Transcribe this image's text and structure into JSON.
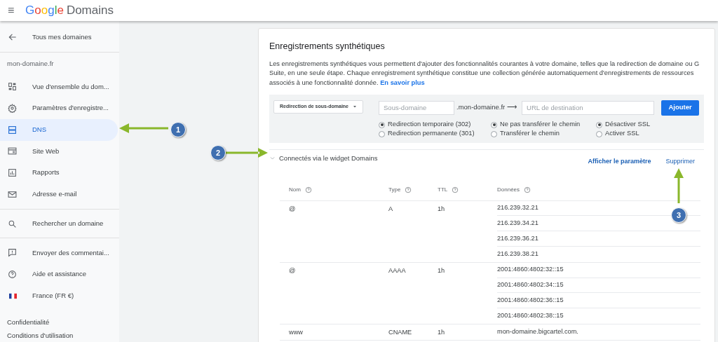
{
  "header": {
    "menu_icon": "≡",
    "logo_brand": "Google",
    "logo_product": "Domains"
  },
  "sidebar": {
    "back": "Tous mes domaines",
    "domain": "mon-domaine.fr",
    "items": [
      {
        "label": "Vue d'ensemble du dom...",
        "selected": false
      },
      {
        "label": "Paramètres d'enregistre...",
        "selected": false
      },
      {
        "label": "DNS",
        "selected": true
      },
      {
        "label": "Site Web",
        "selected": false
      },
      {
        "label": "Rapports",
        "selected": false
      },
      {
        "label": "Adresse e-mail",
        "selected": false
      }
    ],
    "search": "Rechercher un domaine",
    "support": [
      "Envoyer des commentai...",
      "Aide et assistance",
      "France (FR €)"
    ],
    "footer": [
      "Confidentialité",
      "Conditions d'utilisation"
    ]
  },
  "card": {
    "title": "Enregistrements synthétiques",
    "description": "Les enregistrements synthétiques vous permettent d'ajouter des fonctionnalités courantes à votre domaine, telles que la redirection de domaine ou G Suite, en une seule étape. Chaque enregistrement synthétique constitue une collection générée automatiquement d'enregistrements de ressources associés à une fonctionnalité donnée.",
    "learn_more": "En savoir plus",
    "form": {
      "type_select": "Redirection de sous-domaine",
      "subdomain_placeholder": "Sous-domaine",
      "suffix": ".mon-domaine.fr ⟶",
      "url_placeholder": "URL de destination",
      "add_button": "Ajouter",
      "radio_groups": [
        [
          {
            "label": "Redirection temporaire (302)",
            "selected": true
          },
          {
            "label": "Redirection permanente (301)",
            "selected": false
          }
        ],
        [
          {
            "label": "Ne pas transférer le chemin",
            "selected": true
          },
          {
            "label": "Transférer le chemin",
            "selected": false
          }
        ],
        [
          {
            "label": "Désactiver SSL",
            "selected": true
          },
          {
            "label": "Activer SSL",
            "selected": false
          }
        ]
      ]
    },
    "record": {
      "title": "Connectés via le widget Domains",
      "expanded": true,
      "show_settings": "Afficher le paramètre",
      "delete": "Supprimer",
      "columns": [
        "Nom",
        "Type",
        "TTL",
        "Données"
      ],
      "rows": [
        {
          "name": "@",
          "type": "A",
          "ttl": "1h",
          "data": [
            "216.239.32.21",
            "216.239.34.21",
            "216.239.36.21",
            "216.239.38.21"
          ]
        },
        {
          "name": "@",
          "type": "AAAA",
          "ttl": "1h",
          "data": [
            "2001:4860:4802:32::15",
            "2001:4860:4802:34::15",
            "2001:4860:4802:36::15",
            "2001:4860:4802:38::15"
          ]
        },
        {
          "name": "www",
          "type": "CNAME",
          "ttl": "1h",
          "data": [
            "mon-domaine.bigcartel.com."
          ]
        }
      ]
    }
  },
  "annotations": [
    "1",
    "2",
    "3"
  ]
}
